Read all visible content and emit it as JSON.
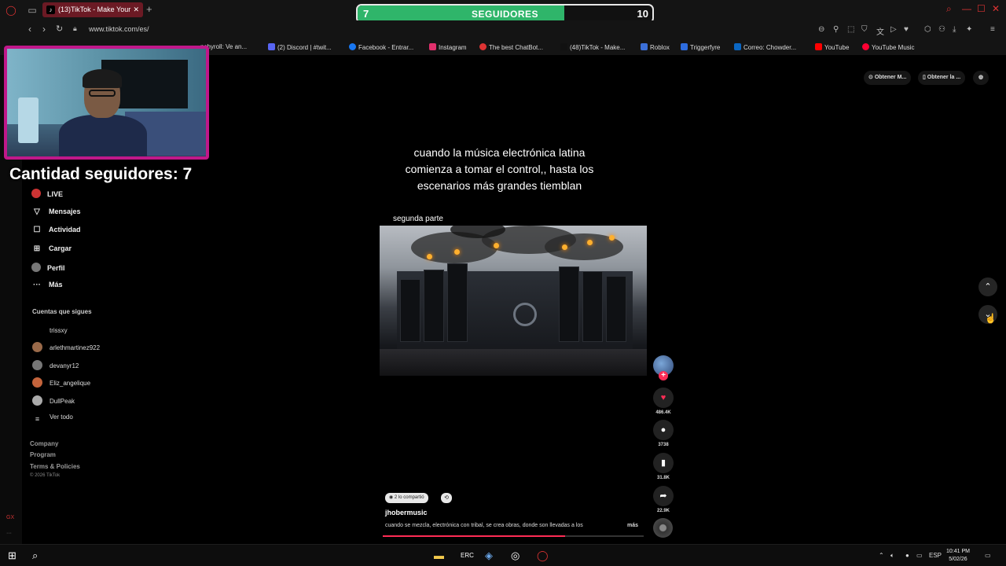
{
  "browser": {
    "tab_title": "(13)TikTok - Make Your",
    "url": "www.tiktok.com/es/"
  },
  "bookmarks": [
    {
      "label": "nchyroll: Ve an...",
      "color": "#f47521"
    },
    {
      "label": "(2) Discord | #twit...",
      "color": "#5865f2"
    },
    {
      "label": "Facebook - Entrar...",
      "color": "#1877f2"
    },
    {
      "label": "Instagram",
      "color": "#e1306c"
    },
    {
      "label": "The best ChatBot...",
      "color": "#d33"
    },
    {
      "label": "(48)TikTok - Make...",
      "color": "#111"
    },
    {
      "label": "Roblox",
      "color": "#3b6fd8"
    },
    {
      "label": "Triggerfyre",
      "color": "#2d6cdf"
    },
    {
      "label": "Correo: Chowder...",
      "color": "#0a66c2"
    },
    {
      "label": "YouTube",
      "color": "#ff0000"
    },
    {
      "label": "YouTube Music",
      "color": "#ff0033"
    }
  ],
  "goal": {
    "current": "7",
    "label": "SEGUIDORES",
    "target": "10",
    "progress": 0.7
  },
  "overlay": {
    "followers_text": "Cantidad seguidores: 7"
  },
  "sidebar": {
    "items": [
      {
        "label": "LIVE",
        "icon": "live-icon"
      },
      {
        "label": "Mensajes",
        "icon": "messages-icon"
      },
      {
        "label": "Actividad",
        "icon": "activity-icon"
      },
      {
        "label": "Cargar",
        "icon": "upload-icon"
      },
      {
        "label": "Perfil",
        "icon": "profile-icon"
      },
      {
        "label": "Más",
        "icon": "more-icon"
      }
    ],
    "following_header": "Cuentas que sigues",
    "accounts": [
      {
        "name": "trissxy",
        "color": "#000"
      },
      {
        "name": "arlethmartinez922",
        "color": "#9a6a4a"
      },
      {
        "name": "devanyr12",
        "color": "#777"
      },
      {
        "name": "Eliz_angelique",
        "color": "#c4643c"
      },
      {
        "name": "DullPeak",
        "color": "#aaa"
      }
    ],
    "see_all": "Ver todo",
    "footer": [
      "Company",
      "Program",
      "Terms & Policies"
    ],
    "copyright": "© 2026 TikTok"
  },
  "topright": {
    "get_app_1": "Obtener M...",
    "get_app_2": "Obtener la ..."
  },
  "video": {
    "caption": "cuando la música electrónica latina comienza a tomar el control,, hasta los escenarios más grandes tiemblan",
    "subtitle": "segunda parte",
    "shared_pill": "2 lo compartió",
    "username": "jhobermusic",
    "description": "cuando se mezcla, electrónica con tribal, se crea obras, donde son llevadas a los",
    "more": "más",
    "progress": 0.7
  },
  "actions": {
    "likes": "486.4K",
    "comments": "3738",
    "saves": "31.8K",
    "shares": "22.9K"
  },
  "taskbar": {
    "lang": "ESP",
    "time": "10:41 PM",
    "date": "5/02/26"
  }
}
